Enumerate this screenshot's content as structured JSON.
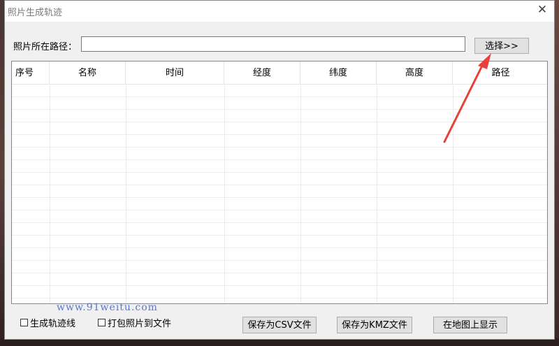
{
  "window": {
    "title": "照片生成轨迹",
    "close_symbol": "✕"
  },
  "path": {
    "label": "照片所在路径：",
    "value": "",
    "placeholder": ""
  },
  "select_button": {
    "label": "选择>>"
  },
  "table": {
    "columns": [
      "序号",
      "名称",
      "时间",
      "经度",
      "纬度",
      "高度",
      "路径"
    ],
    "rows": []
  },
  "options": {
    "generate_track": {
      "label": "生成轨迹线",
      "checked": false
    },
    "pack_photos": {
      "label": "打包照片到文件",
      "checked": false
    }
  },
  "buttons": {
    "save_csv": "保存为CSV文件",
    "save_kmz": "保存为KMZ文件",
    "show_map": "在地图上显示"
  },
  "watermark": "www.91weitu.com",
  "colors": {
    "arrow": "#e8403a",
    "watermark": "#5b79c8",
    "dialog_bg": "#f0f0f0"
  }
}
